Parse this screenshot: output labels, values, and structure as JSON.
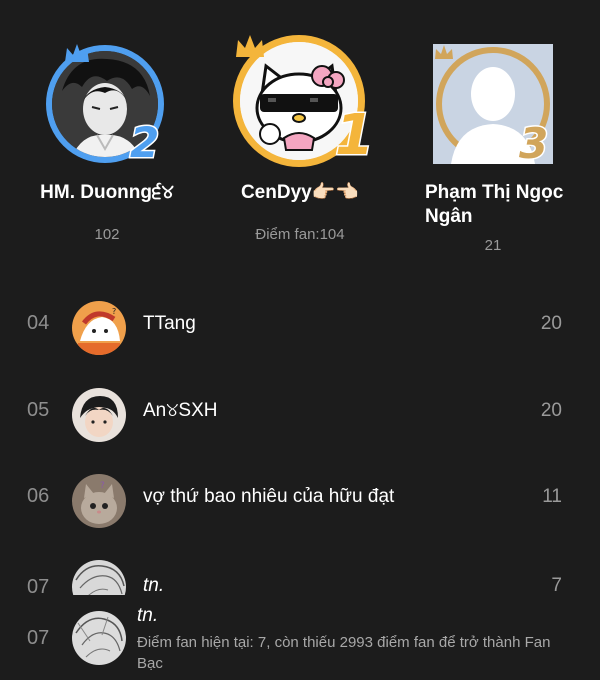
{
  "podium": [
    {
      "rank_badge": "2",
      "name": "HM. Duonng੬୪",
      "score": "102",
      "ring_color": "#4f9ff0"
    },
    {
      "rank_badge": "1",
      "name": "CenDyy👉🏻👈🏻",
      "score": "Điểm fan:104",
      "ring_color": "#f4b53b"
    },
    {
      "rank_badge": "3",
      "name": "Phạm Thị Ngọc Ngân",
      "score": "21",
      "ring_color": "#d1a55b"
    }
  ],
  "list": [
    {
      "rank": "04",
      "name": "TTang",
      "score": "20"
    },
    {
      "rank": "05",
      "name": "An୪SXH",
      "score": "20"
    },
    {
      "rank": "06",
      "name": "vợ thứ bao nhiêu của hữu đạt",
      "score": "11"
    },
    {
      "rank": "07",
      "name": "tn.",
      "score": "7"
    }
  ],
  "me": {
    "rank": "07",
    "name": "tn.",
    "note": "Điểm fan hiện tại: 7, còn thiếu 2993 điểm fan để trở thành Fan Bạc"
  },
  "colors": {
    "background": "#1c1c1c",
    "gold": "#f4b53b",
    "silver_blue": "#4f9ff0",
    "bronze": "#d1a55b"
  }
}
